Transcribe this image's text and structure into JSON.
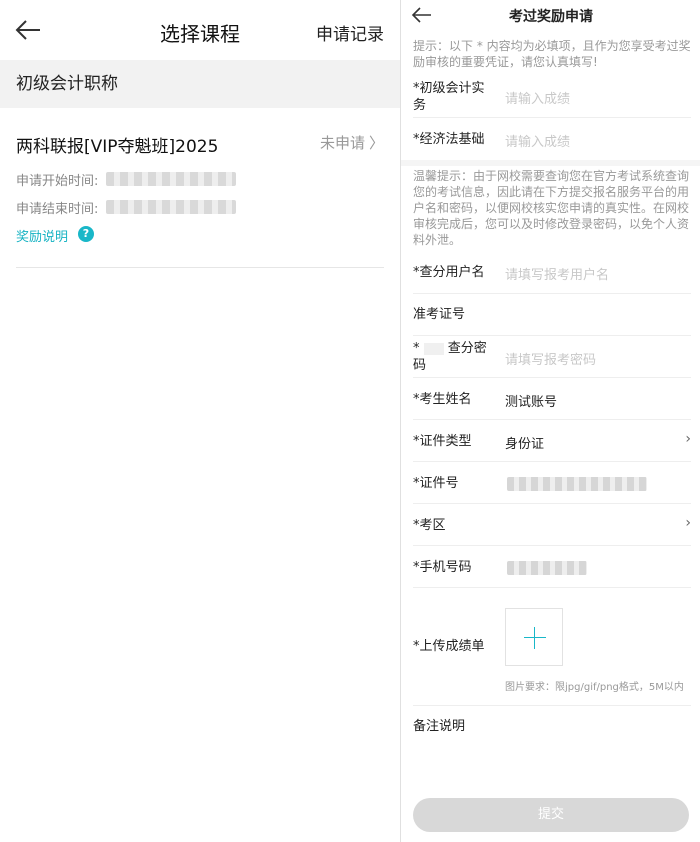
{
  "left": {
    "title": "选择课程",
    "records_label": "申请记录",
    "category": "初级会计职称",
    "course": {
      "name": "两科联报[VIP夺魁班]2025",
      "status": "未申请",
      "start_label": "申请开始时间:",
      "end_label": "申请结束时间:",
      "reward_link": "奖励说明",
      "help_glyph": "?"
    }
  },
  "right": {
    "title": "考过奖励申请",
    "hint1": "提示：以下 * 内容均为必填项，且作为您享受考过奖励审核的重要凭证，请您认真填写!",
    "hint2": "温馨提示：由于网校需要查询您在官方考试系统查询您的考试信息，因此请在下方提交报名服务平台的用户名和密码，以便网校核实您申请的真实性。在网校审核完成后，您可以及时修改登录密码，以免个人资料外泄。",
    "fields": {
      "subject1_label": "*初级会计实务",
      "subject1_ph": "请输入成绩",
      "subject2_label": "*经济法基础",
      "subject2_ph": "请输入成绩",
      "username_label": "*查分用户名",
      "username_ph": "请填写报考用户名",
      "ticket_label": "准考证号",
      "password_label_star": "*",
      "password_label": "查分密码",
      "password_ph": "请填写报考密码",
      "name_label": "*考生姓名",
      "name_value": "测试账号",
      "idtype_label": "*证件类型",
      "idtype_value": "身份证",
      "idno_label": "*证件号",
      "region_label": "*考区",
      "phone_label": "*手机号码",
      "upload_label": "*上传成绩单",
      "upload_hint": "图片要求：限jpg/gif/png格式，5M以内",
      "remark_label": "备注说明"
    },
    "submit_label": "提交",
    "chevron": "›"
  },
  "colors": {
    "accent": "#19b7c8",
    "placeholder": "#c8c8c8",
    "submit_disabled": "#d8d8d8"
  }
}
